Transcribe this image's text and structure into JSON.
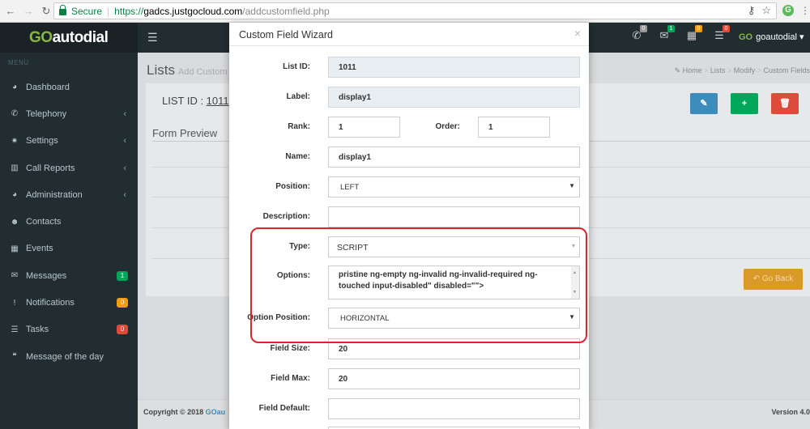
{
  "browser": {
    "secure_label": "Secure",
    "url_scheme": "https://",
    "url_host": "gadcs.justgocloud.com",
    "url_path": "/addcustomfield.php"
  },
  "header": {
    "logo_go": "GO",
    "logo_rest": "autodial",
    "user_prefix": "GO",
    "username": "goautodial",
    "icon_badges": [
      {
        "icon": "phone-icon",
        "count": "0",
        "color": "#999999"
      },
      {
        "icon": "envelope-icon",
        "count": "1",
        "color": "#00a65a"
      },
      {
        "icon": "calendar-icon",
        "count": "0",
        "color": "#f39c12"
      },
      {
        "icon": "tasks-icon",
        "count": "0",
        "color": "#dd4b39"
      }
    ]
  },
  "sidebar": {
    "menu_label": "MENU",
    "items": [
      {
        "label": "Dashboard",
        "icon": "dashboard-icon",
        "glyph": "◕",
        "chevron": false
      },
      {
        "label": "Telephony",
        "icon": "phone-icon",
        "glyph": "✆",
        "chevron": true
      },
      {
        "label": "Settings",
        "icon": "gear-icon",
        "glyph": "✷",
        "chevron": true
      },
      {
        "label": "Call Reports",
        "icon": "bar-chart-icon",
        "glyph": "▥",
        "chevron": true
      },
      {
        "label": "Administration",
        "icon": "dashboard-icon",
        "glyph": "◕",
        "chevron": true
      },
      {
        "label": "Contacts",
        "icon": "users-icon",
        "glyph": "☻",
        "chevron": false
      },
      {
        "label": "Events",
        "icon": "calendar-icon",
        "glyph": "▦",
        "chevron": false
      },
      {
        "label": "Messages",
        "icon": "envelope-icon",
        "glyph": "✉",
        "count": "1",
        "count_color": "#00a65a"
      },
      {
        "label": "Notifications",
        "icon": "exclamation-icon",
        "glyph": "!",
        "count": "0",
        "count_color": "#f39c12"
      },
      {
        "label": "Tasks",
        "icon": "tasks-icon",
        "glyph": "☰",
        "count": "0",
        "count_color": "#dd4b39"
      },
      {
        "label": "Message of the day",
        "icon": "quote-icon",
        "glyph": "❝",
        "chevron": false
      }
    ]
  },
  "content": {
    "title": "Lists",
    "subtitle": "Add Custom F",
    "breadcrumb": [
      "Home",
      "Lists",
      "Modify",
      "Custom Fields"
    ],
    "list_id_label": "LIST ID : ",
    "list_id_value": "1011",
    "form_preview": "Form Preview",
    "go_back": "Go Back",
    "copyright_prefix": "Copyright © 2018 ",
    "copyright_brand": "GOau",
    "version": "Version 4.0",
    "action_colors": {
      "edit": "#3c8dbc",
      "add": "#00a65a",
      "delete": "#dd4b39"
    }
  },
  "modal": {
    "title": "Custom Field Wizard",
    "close": "×",
    "list_id_label": "List ID:",
    "list_id_value": "1011",
    "label_label": "Label:",
    "label_value": "display1",
    "rank_label": "Rank:",
    "rank_value": "1",
    "order_label": "Order:",
    "order_value": "1",
    "name_label": "Name:",
    "name_value": "display1",
    "position_label": "Position:",
    "position_value": "LEFT",
    "description_label": "Description:",
    "description_value": "",
    "type_label": "Type:",
    "type_value": "SCRIPT",
    "options_label": "Options:",
    "options_lines": [
      "pristine ng-empty ng-invalid ng-invalid-required ng-",
      "touched input-disabled\" disabled=\"\">"
    ],
    "option_position_label": "Option Position:",
    "option_position_value": "HORIZONTAL",
    "field_size_label": "Field Size:",
    "field_size_value": "20",
    "field_max_label": "Field Max:",
    "field_max_value": "20",
    "field_default_label": "Field Default:",
    "field_default_value": ""
  }
}
